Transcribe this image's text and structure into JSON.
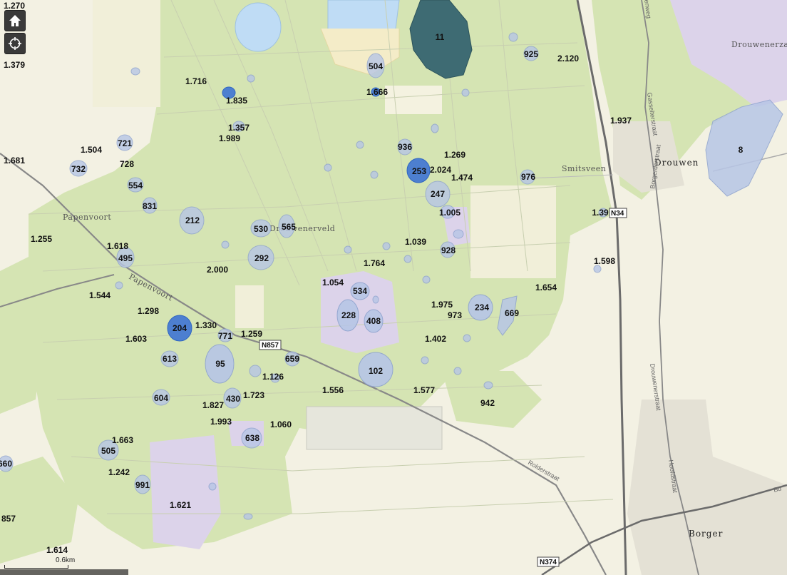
{
  "map": {
    "place_names": [
      {
        "label": "Papenvoort"
      },
      {
        "label": "Papenvoort"
      },
      {
        "label": "Drouwenerveld"
      },
      {
        "label": "Smitsveen"
      },
      {
        "label": "Drouwenerzand"
      },
      {
        "label": "Drouwen"
      },
      {
        "label": "Borger"
      }
    ],
    "street_names": [
      {
        "label": "Gasselterstraat"
      },
      {
        "label": "Borgerderstraat"
      },
      {
        "label": "Drouwenerstraat"
      },
      {
        "label": "Hoofdstraat"
      },
      {
        "label": "Rolderstraat"
      },
      {
        "label": "enweg"
      },
      {
        "label": "Bu"
      }
    ],
    "road_shields": [
      {
        "label": "N857"
      },
      {
        "label": "N34"
      },
      {
        "label": "N374"
      }
    ],
    "markers": [
      "1.270",
      "1.379",
      "1.716",
      "1.835",
      "1.357",
      "1.989",
      "1.504",
      "721",
      "728",
      "732",
      "554",
      "1.681",
      "831",
      "212",
      "530",
      "565",
      "292",
      "1.255",
      "1.618",
      "495",
      "2.000",
      "1.544",
      "1.298",
      "204",
      "1.330",
      "771",
      "1.259",
      "1.603",
      "613",
      "95",
      "659",
      "1.126",
      "604",
      "1.827",
      "430",
      "1.723",
      "1.993",
      "638",
      "1.060",
      "505",
      "1.663",
      "1.242",
      "991",
      "1.621",
      "660",
      "857",
      "1.614",
      "504",
      "1.666",
      "11",
      "925",
      "2.120",
      "936",
      "253",
      "2.024",
      "1.269",
      "1.474",
      "247",
      "1.005",
      "1.039",
      "928",
      "1.764",
      "1.054",
      "534",
      "228",
      "408",
      "1.975",
      "973",
      "234",
      "669",
      "1.402",
      "102",
      "1.556",
      "1.577",
      "942",
      "1.654",
      "976",
      "1.937",
      "8",
      "1.39",
      "1.598"
    ],
    "scale_label": "0.6km"
  },
  "controls": {
    "home_icon": "home-icon",
    "locate_icon": "crosshair-icon"
  },
  "colors": {
    "forest": "#d5e4b3",
    "open": "#f3f1e3",
    "heath": "#dcd3ea",
    "water": "#bfdcf5",
    "marker": "#b7c6e6",
    "marker_dark": "#2f66c2",
    "marker_teal": "#3e6b73"
  }
}
